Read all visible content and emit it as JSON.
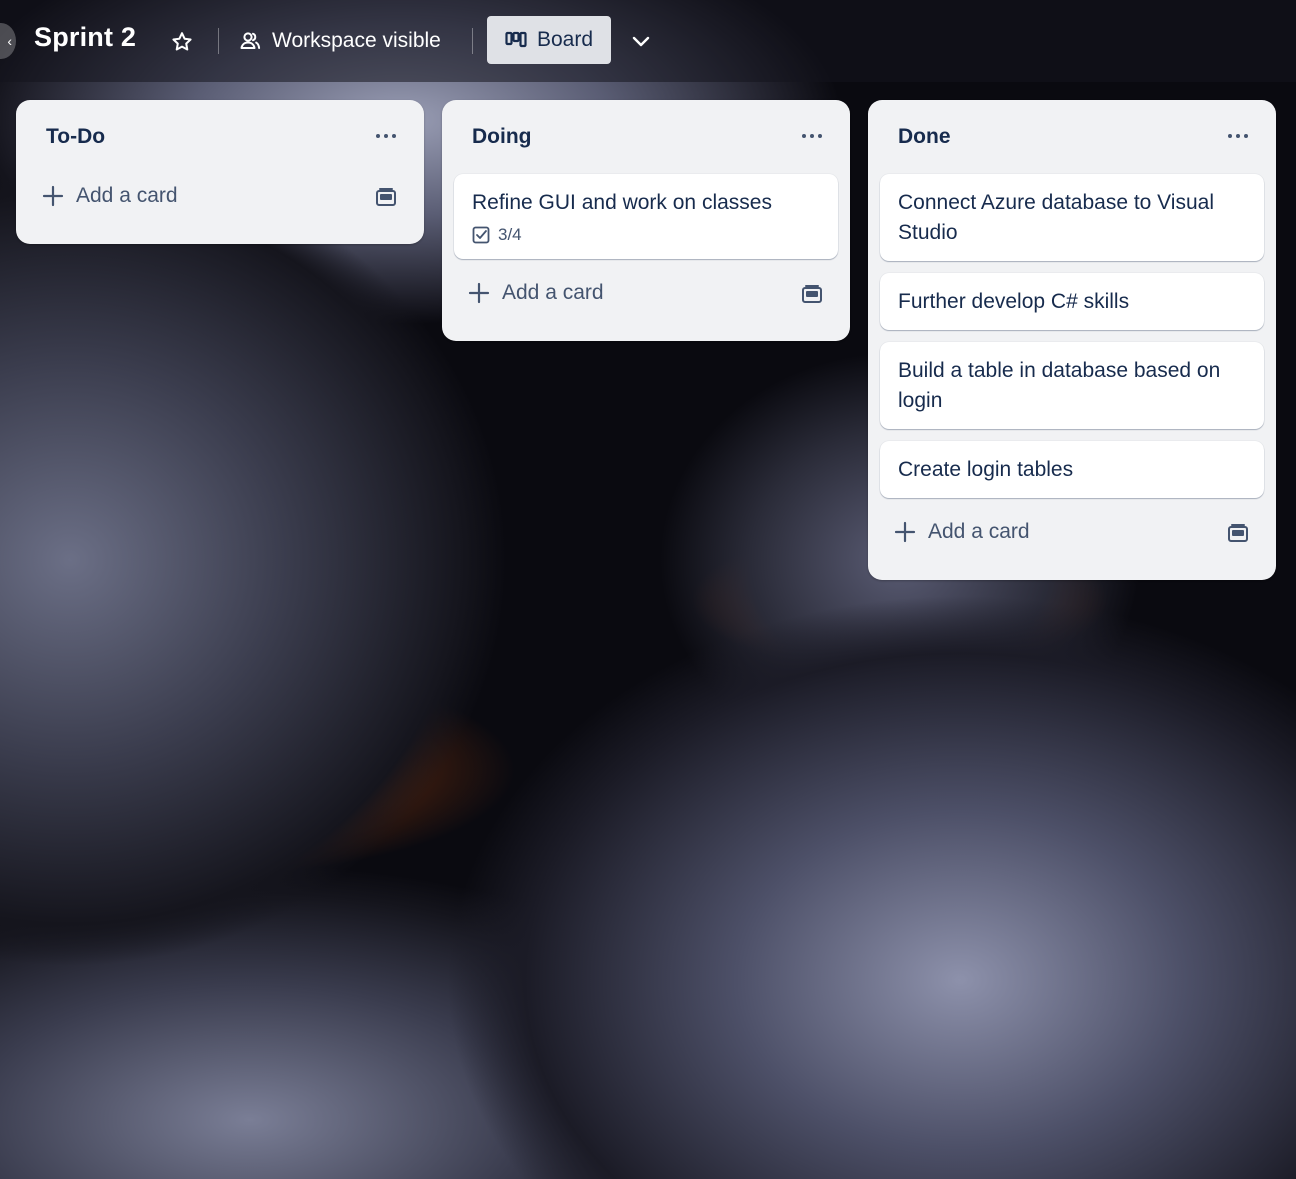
{
  "header": {
    "board_title": "Sprint 2",
    "visibility_label": "Workspace visible",
    "view_label": "Board"
  },
  "lists": [
    {
      "title": "To-Do",
      "cards": [],
      "add_card_label": "Add a card"
    },
    {
      "title": "Doing",
      "cards": [
        {
          "title": "Refine GUI and work on classes",
          "checklist": "3/4"
        }
      ],
      "add_card_label": "Add a card"
    },
    {
      "title": "Done",
      "cards": [
        {
          "title": "Connect Azure database to Visual Studio"
        },
        {
          "title": "Further develop C# skills"
        },
        {
          "title": "Build a table in database based on login"
        },
        {
          "title": "Create login tables"
        }
      ],
      "add_card_label": "Add a card"
    }
  ],
  "icons": {
    "star": "star-icon",
    "visibility": "people-icon",
    "board_view": "board-icon",
    "chevron": "chevron-down-icon",
    "list_menu": "more-icon",
    "add": "plus-icon",
    "template": "card-template-icon",
    "checklist": "checklist-icon"
  }
}
